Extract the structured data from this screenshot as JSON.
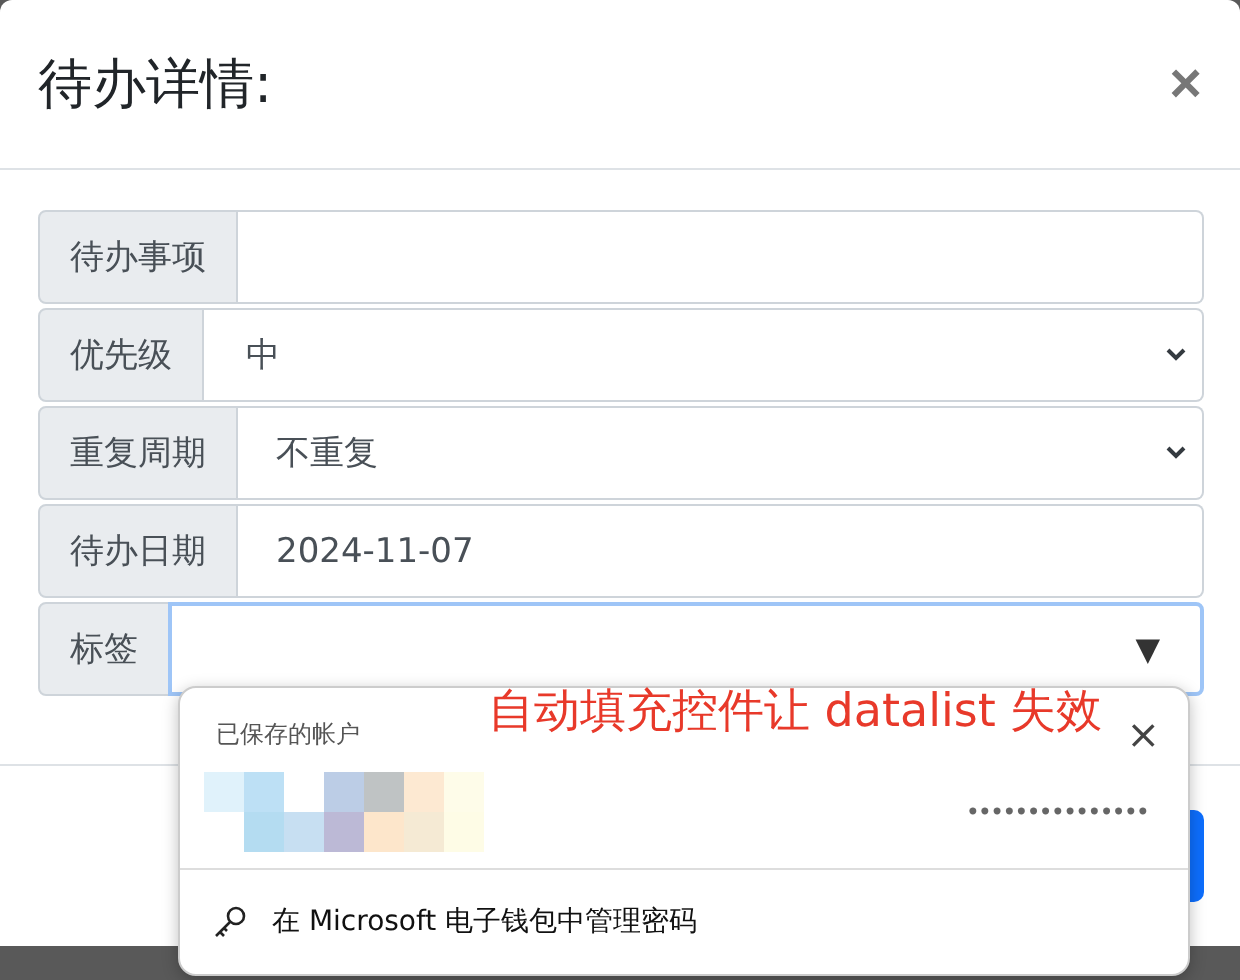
{
  "dialog": {
    "title": "待办详情:",
    "close": "×"
  },
  "fields": [
    {
      "kind": "text",
      "label": "待办事项"
    },
    {
      "kind": "select",
      "label": "优先级",
      "value": "中"
    },
    {
      "kind": "select",
      "label": "重复周期",
      "value": "不重复"
    },
    {
      "kind": "text",
      "label": "待办日期",
      "value": "2024-11-07"
    },
    {
      "kind": "datalist",
      "label": "标签",
      "arrow": "▼",
      "focused": true
    }
  ],
  "autofill_popup": {
    "heading": "已保存的帐户",
    "account": {
      "kind": "picture",
      "password": "•••••••••••••••"
    },
    "manage_link": "在 Microsoft 电子钱包中管理密码",
    "close": "×"
  },
  "annotation": "自动填充控件让 datalist 失效"
}
